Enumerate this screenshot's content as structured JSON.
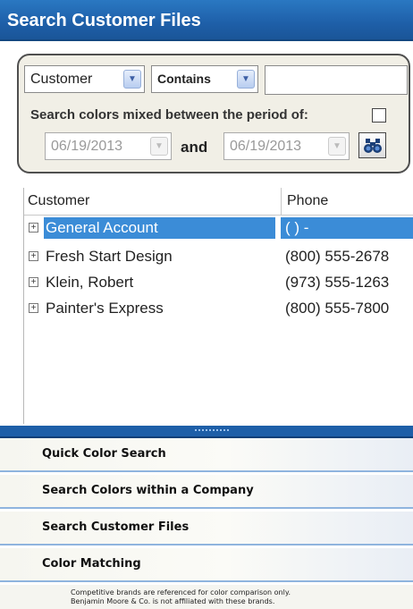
{
  "header": {
    "title": "Search Customer Files"
  },
  "search": {
    "field": "Customer",
    "operator": "Contains",
    "query": "",
    "period_label": "Search colors mixed between the period of:",
    "period_enabled": false,
    "date_from": "06/19/2013",
    "and_label": "and",
    "date_to": "06/19/2013"
  },
  "grid": {
    "columns": [
      "Customer",
      "Phone"
    ],
    "rows": [
      {
        "name": "General Account",
        "phone": "(  )   -",
        "selected": true
      },
      {
        "name": "Fresh Start Design",
        "phone": "(800) 555-2678"
      },
      {
        "name": "Klein, Robert",
        "phone": "(973) 555-1263"
      },
      {
        "name": "Painter's Express",
        "phone": "(800) 555-7800"
      }
    ]
  },
  "nav": {
    "items": [
      {
        "label": "Quick Color Search"
      },
      {
        "label": "Search Colors within a Company"
      },
      {
        "label": "Search Customer Files"
      },
      {
        "label": "Color Matching"
      }
    ]
  },
  "footer": {
    "line1": "Competitive brands are referenced for color comparison only.",
    "line2": "Benjamin Moore & Co. is not affiliated with these brands."
  },
  "colors": {
    "title_bar": "#1e5fa8",
    "selection": "#3b8cd7",
    "nav_border": "#8fb4de"
  }
}
